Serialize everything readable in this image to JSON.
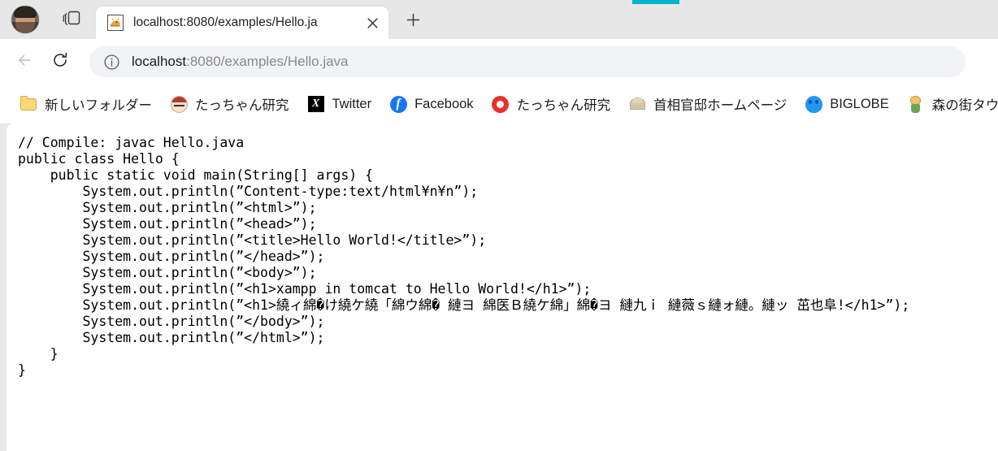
{
  "window": {
    "accent_color": "#00b4cc",
    "toolbar_bg": "#ffffff",
    "frame_bg": "#e7e7e7"
  },
  "tabstrip": {
    "profile_name": "profile-avatar",
    "collections_label": "Collections",
    "tab": {
      "favicon": "tomcat-icon",
      "title": "localhost:8080/examples/Hello.ja",
      "close_label": "✕"
    },
    "new_tab_label": "+"
  },
  "navbar": {
    "back_label": "←",
    "refresh_label": "↻",
    "info_label": "i",
    "url_host": "localhost",
    "url_path": ":8080/examples/Hello.java",
    "url_full": "localhost:8080/examples/Hello.java"
  },
  "bookmarks": [
    {
      "icon": "folder-icon",
      "label": "新しいフォルダー"
    },
    {
      "icon": "tacchan-face-icon",
      "label": "たっちゃん研究"
    },
    {
      "icon": "x-twitter-icon",
      "label": "Twitter"
    },
    {
      "icon": "facebook-icon",
      "label": "Facebook"
    },
    {
      "icon": "tacchan-red-icon",
      "label": "たっちゃん研究"
    },
    {
      "icon": "kantei-icon",
      "label": "首相官邸ホームページ"
    },
    {
      "icon": "biglobe-icon",
      "label": "BIGLOBE"
    },
    {
      "icon": "mori-no-machi-icon",
      "label": "森の街タウ"
    }
  ],
  "page": {
    "content_type": "plain-text-source",
    "code": "// Compile: javac Hello.java\npublic class Hello {\n    public static void main(String[] args) {\n        System.out.println(”Content-type:text/html¥n¥n”);\n        System.out.println(”<html>”);\n        System.out.println(”<head>”);\n        System.out.println(”<title>Hello World!</title>”);\n        System.out.println(”</head>”);\n        System.out.println(”<body>”);\n        System.out.println(”<h1>xampp in tomcat to Hello World!</h1>”);\n        System.out.println(”<h1>繞ィ綿�け繞ケ繞「綿ウ綿� 縺ヨ 綿医Ｂ繞ケ綿」綿�ヨ 縺九ｉ 縺薇ｓ縺ォ縺。縺ッ 茁也阜!</h1>”);\n        System.out.println(”</body>”);\n        System.out.println(”</html>”);\n    }\n}"
  }
}
